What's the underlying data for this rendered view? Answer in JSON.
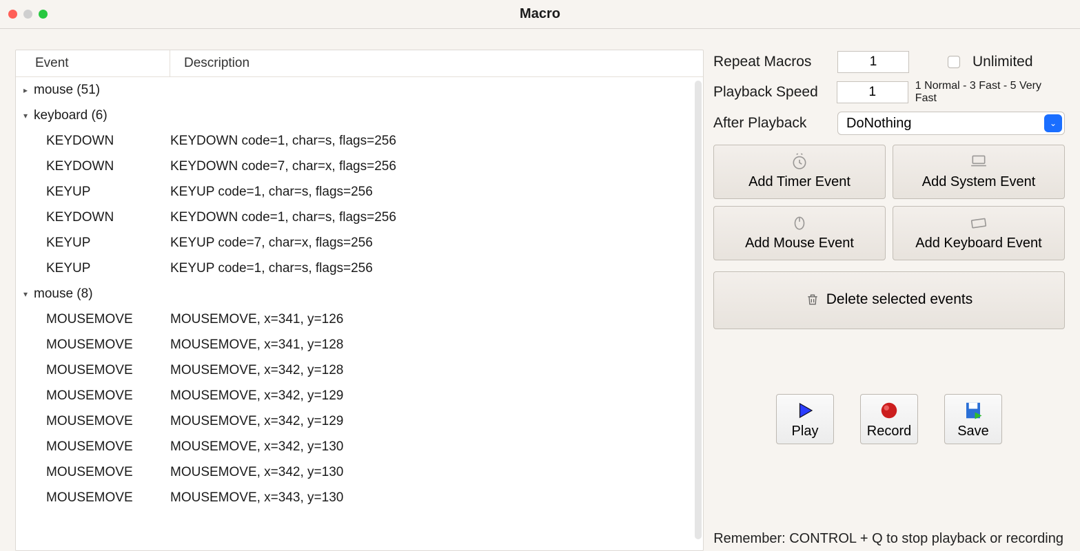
{
  "window": {
    "title": "Macro"
  },
  "columns": {
    "event": "Event",
    "description": "Description"
  },
  "tree": [
    {
      "type": "group",
      "expanded": false,
      "label": "mouse (51)"
    },
    {
      "type": "group",
      "expanded": true,
      "label": "keyboard (6)"
    },
    {
      "type": "leaf",
      "event": "KEYDOWN",
      "desc": "KEYDOWN code=1, char=s, flags=256"
    },
    {
      "type": "leaf",
      "event": "KEYDOWN",
      "desc": "KEYDOWN code=7, char=x, flags=256"
    },
    {
      "type": "leaf",
      "event": "KEYUP",
      "desc": "KEYUP code=1, char=s, flags=256"
    },
    {
      "type": "leaf",
      "event": "KEYDOWN",
      "desc": "KEYDOWN code=1, char=s, flags=256"
    },
    {
      "type": "leaf",
      "event": "KEYUP",
      "desc": "KEYUP code=7, char=x, flags=256"
    },
    {
      "type": "leaf",
      "event": "KEYUP",
      "desc": "KEYUP code=1, char=s, flags=256"
    },
    {
      "type": "group",
      "expanded": true,
      "label": "mouse (8)"
    },
    {
      "type": "leaf",
      "event": "MOUSEMOVE",
      "desc": "MOUSEMOVE, x=341, y=126"
    },
    {
      "type": "leaf",
      "event": "MOUSEMOVE",
      "desc": "MOUSEMOVE, x=341, y=128"
    },
    {
      "type": "leaf",
      "event": "MOUSEMOVE",
      "desc": "MOUSEMOVE, x=342, y=128"
    },
    {
      "type": "leaf",
      "event": "MOUSEMOVE",
      "desc": "MOUSEMOVE, x=342, y=129"
    },
    {
      "type": "leaf",
      "event": "MOUSEMOVE",
      "desc": "MOUSEMOVE, x=342, y=129"
    },
    {
      "type": "leaf",
      "event": "MOUSEMOVE",
      "desc": "MOUSEMOVE, x=342, y=130"
    },
    {
      "type": "leaf",
      "event": "MOUSEMOVE",
      "desc": "MOUSEMOVE, x=342, y=130"
    },
    {
      "type": "leaf",
      "event": "MOUSEMOVE",
      "desc": "MOUSEMOVE, x=343, y=130"
    }
  ],
  "settings": {
    "repeat_label": "Repeat Macros",
    "repeat_value": "1",
    "unlimited_label": "Unlimited",
    "speed_label": "Playback Speed",
    "speed_value": "1",
    "speed_hint": "1 Normal - 3 Fast - 5 Very Fast",
    "after_label": "After Playback",
    "after_value": "DoNothing"
  },
  "buttons": {
    "add_timer": "Add Timer Event",
    "add_system": "Add System Event",
    "add_mouse": "Add Mouse Event",
    "add_keyboard": "Add Keyboard Event",
    "delete": "Delete selected events",
    "play": "Play",
    "record": "Record",
    "save": "Save"
  },
  "footer": "Remember: CONTROL + Q to stop playback or recording"
}
